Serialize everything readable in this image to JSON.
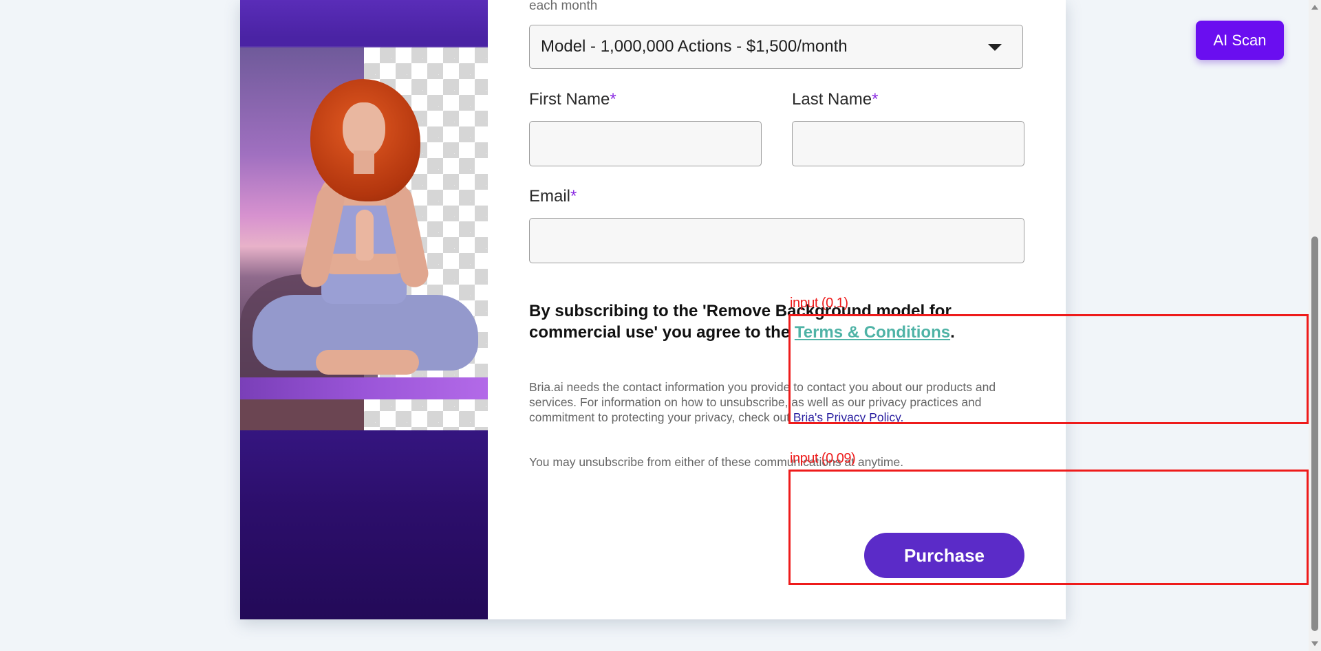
{
  "form": {
    "plan_note": "each month",
    "plan_select_value": "Model - 1,000,000 Actions - $1,500/month",
    "first_name_label": "First Name",
    "last_name_label": "Last Name",
    "email_label": "Email",
    "required_mark": "*",
    "consent_text_before": "By subscribing to the 'Remove Background model for commercial use' you agree to the ",
    "consent_link": "Terms & Conditions",
    "consent_text_after": ".",
    "privacy_text": "Bria.ai needs the contact information you provide to contact you about our products and services. For information on how to unsubscribe, as well as our privacy practices and commitment to protecting your privacy, check out ",
    "privacy_link": "Bria's Privacy Policy.",
    "unsubscribe_text": "You may unsubscribe from either of these communications at anytime.",
    "purchase_label": "Purchase"
  },
  "overlay": {
    "box1_label": "input (0.1)",
    "box2_label": "input (0.09)",
    "color": "#ee1b1b"
  },
  "ai_scan": {
    "label": "AI Scan"
  },
  "colors": {
    "accent": "#5b2bc8",
    "panel": "#3a1a8c",
    "link": "#4fb3a6",
    "ai_scan": "#6a0ef0"
  }
}
